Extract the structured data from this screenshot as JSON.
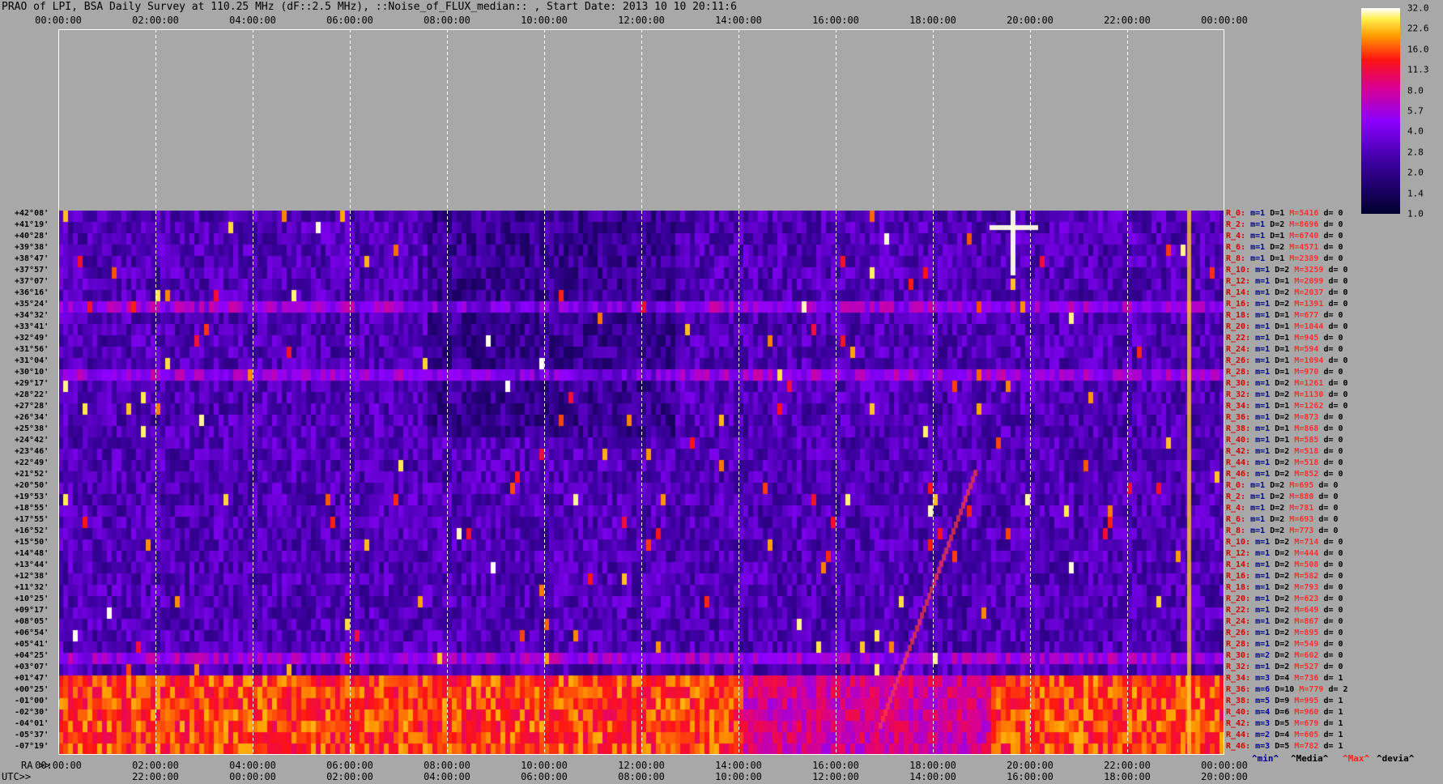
{
  "title": "PRAO of LPI, BSA Daily Survey at 110.25 MHz (dF::2.5 MHz), ::Noise_of_FLUX_median:: , Start Date: 2013 10 10 20:11:6",
  "colors": {
    "background": "#a8a8a8",
    "grid": "#ffffff",
    "low": "#000040",
    "mid": "#8800ff",
    "high": "#ffffff"
  },
  "top_axis_ticks": [
    "00:00:00",
    "02:00:00",
    "04:00:00",
    "06:00:00",
    "08:00:00",
    "10:00:00",
    "12:00:00",
    "14:00:00",
    "16:00:00",
    "18:00:00",
    "20:00:00",
    "22:00:00",
    "00:00:00"
  ],
  "bottom_axis": {
    "ra_label": "RA >>",
    "utc_label": "UTC>>",
    "ra_ticks": [
      "00:00:00",
      "02:00:00",
      "04:00:00",
      "06:00:00",
      "08:00:00",
      "10:00:00",
      "12:00:00",
      "14:00:00",
      "16:00:00",
      "18:00:00",
      "20:00:00",
      "22:00:00",
      "00:00:00"
    ],
    "utc_ticks": [
      "22:00:00",
      "00:00:00",
      "02:00:00",
      "04:00:00",
      "06:00:00",
      "08:00:00",
      "10:00:00",
      "12:00:00",
      "14:00:00",
      "16:00:00",
      "18:00:00",
      "20:00:00"
    ]
  },
  "footer_labels": {
    "min": "^min^",
    "median": "^Media^",
    "max": "^Max^",
    "devia": "^devia^"
  },
  "colorbar_ticks": [
    "32.0",
    "22.6",
    "16.0",
    "11.3",
    "8.0",
    "5.7",
    "4.0",
    "2.8",
    "2.0",
    "1.4",
    "1.0"
  ],
  "chart_data": {
    "type": "heatmap",
    "title": "PRAO of LPI, BSA Daily Survey at 110.25 MHz (dF::2.5 MHz), ::Noise_of_FLUX_median:: , Start Date: 2013 10 10 20:11:6",
    "x_axis": "RA / UTC hours",
    "scale": [
      1.0,
      32.0
    ],
    "declinations": [
      "+42°08'",
      "+41°19'",
      "+40°28'",
      "+39°38'",
      "+38°47'",
      "+37°57'",
      "+37°07'",
      "+36°16'",
      "+35°24'",
      "+34°32'",
      "+33°41'",
      "+32°49'",
      "+31°56'",
      "+31°04'",
      "+30°10'",
      "+29°17'",
      "+28°22'",
      "+27°28'",
      "+26°34'",
      "+25°38'",
      "+24°42'",
      "+23°46'",
      "+22°49'",
      "+21°52'",
      "+20°50'",
      "+19°53'",
      "+18°55'",
      "+17°55'",
      "+16°52'",
      "+15°50'",
      "+14°48'",
      "+13°44'",
      "+12°38'",
      "+11°32'",
      "+10°25'",
      "+09°17'",
      "+08°05'",
      "+06°54'",
      "+05°41'",
      "+04°25'",
      "+03°07'",
      "+01°47'",
      "+00°25'",
      "-01°00'",
      "-02°30'",
      "-04°01'",
      "-05°37'",
      "-07°19'"
    ],
    "row_stats": [
      {
        "r": "R_0:",
        "m": "m=1",
        "D": "D=1",
        "M": "M=5416",
        "d": "d= 0"
      },
      {
        "r": "R_2:",
        "m": "m=1",
        "D": "D=2",
        "M": "M=8696",
        "d": "d= 0"
      },
      {
        "r": "R_4:",
        "m": "m=1",
        "D": "D=1",
        "M": "M=6740",
        "d": "d= 0"
      },
      {
        "r": "R_6:",
        "m": "m=1",
        "D": "D=2",
        "M": "M=4571",
        "d": "d= 0"
      },
      {
        "r": "R_8:",
        "m": "m=1",
        "D": "D=1",
        "M": "M=2389",
        "d": "d= 0"
      },
      {
        "r": "R_10:",
        "m": "m=1",
        "D": "D=2",
        "M": "M=3259",
        "d": "d= 0"
      },
      {
        "r": "R_12:",
        "m": "m=1",
        "D": "D=1",
        "M": "M=2099",
        "d": "d= 0"
      },
      {
        "r": "R_14:",
        "m": "m=1",
        "D": "D=2",
        "M": "M=2037",
        "d": "d= 0"
      },
      {
        "r": "R_16:",
        "m": "m=1",
        "D": "D=2",
        "M": "M=1391",
        "d": "d= 0"
      },
      {
        "r": "R_18:",
        "m": "m=1",
        "D": "D=1",
        "M": "M=677",
        "d": "d= 0"
      },
      {
        "r": "R_20:",
        "m": "m=1",
        "D": "D=1",
        "M": "M=1044",
        "d": "d= 0"
      },
      {
        "r": "R_22:",
        "m": "m=1",
        "D": "D=1",
        "M": "M=945",
        "d": "d= 0"
      },
      {
        "r": "R_24:",
        "m": "m=1",
        "D": "D=1",
        "M": "M=594",
        "d": "d= 0"
      },
      {
        "r": "R_26:",
        "m": "m=1",
        "D": "D=1",
        "M": "M=1094",
        "d": "d= 0"
      },
      {
        "r": "R_28:",
        "m": "m=1",
        "D": "D=1",
        "M": "M=970",
        "d": "d= 0"
      },
      {
        "r": "R_30:",
        "m": "m=1",
        "D": "D=2",
        "M": "M=1261",
        "d": "d= 0"
      },
      {
        "r": "R_32:",
        "m": "m=1",
        "D": "D=2",
        "M": "M=1130",
        "d": "d= 0"
      },
      {
        "r": "R_34:",
        "m": "m=1",
        "D": "D=1",
        "M": "M=1262",
        "d": "d= 0"
      },
      {
        "r": "R_36:",
        "m": "m=1",
        "D": "D=2",
        "M": "M=873",
        "d": "d= 0"
      },
      {
        "r": "R_38:",
        "m": "m=1",
        "D": "D=1",
        "M": "M=868",
        "d": "d= 0"
      },
      {
        "r": "R_40:",
        "m": "m=1",
        "D": "D=1",
        "M": "M=585",
        "d": "d= 0"
      },
      {
        "r": "R_42:",
        "m": "m=1",
        "D": "D=2",
        "M": "M=518",
        "d": "d= 0"
      },
      {
        "r": "R_44:",
        "m": "m=1",
        "D": "D=2",
        "M": "M=518",
        "d": "d= 0"
      },
      {
        "r": "R_46:",
        "m": "m=1",
        "D": "D=2",
        "M": "M=852",
        "d": "d= 0"
      },
      {
        "r": "R_0:",
        "m": "m=1",
        "D": "D=2",
        "M": "M=695",
        "d": "d= 0"
      },
      {
        "r": "R_2:",
        "m": "m=1",
        "D": "D=2",
        "M": "M=880",
        "d": "d= 0"
      },
      {
        "r": "R_4:",
        "m": "m=1",
        "D": "D=2",
        "M": "M=781",
        "d": "d= 0"
      },
      {
        "r": "R_6:",
        "m": "m=1",
        "D": "D=2",
        "M": "M=693",
        "d": "d= 0"
      },
      {
        "r": "R_8:",
        "m": "m=1",
        "D": "D=2",
        "M": "M=773",
        "d": "d= 0"
      },
      {
        "r": "R_10:",
        "m": "m=1",
        "D": "D=2",
        "M": "M=714",
        "d": "d= 0"
      },
      {
        "r": "R_12:",
        "m": "m=1",
        "D": "D=2",
        "M": "M=444",
        "d": "d= 0"
      },
      {
        "r": "R_14:",
        "m": "m=1",
        "D": "D=2",
        "M": "M=508",
        "d": "d= 0"
      },
      {
        "r": "R_16:",
        "m": "m=1",
        "D": "D=2",
        "M": "M=582",
        "d": "d= 0"
      },
      {
        "r": "R_18:",
        "m": "m=1",
        "D": "D=2",
        "M": "M=793",
        "d": "d= 0"
      },
      {
        "r": "R_20:",
        "m": "m=1",
        "D": "D=2",
        "M": "M=623",
        "d": "d= 0"
      },
      {
        "r": "R_22:",
        "m": "m=1",
        "D": "D=2",
        "M": "M=649",
        "d": "d= 0"
      },
      {
        "r": "R_24:",
        "m": "m=1",
        "D": "D=2",
        "M": "M=867",
        "d": "d= 0"
      },
      {
        "r": "R_26:",
        "m": "m=1",
        "D": "D=2",
        "M": "M=895",
        "d": "d= 0"
      },
      {
        "r": "R_28:",
        "m": "m=1",
        "D": "D=2",
        "M": "M=549",
        "d": "d= 0"
      },
      {
        "r": "R_30:",
        "m": "m=2",
        "D": "D=2",
        "M": "M=602",
        "d": "d= 0"
      },
      {
        "r": "R_32:",
        "m": "m=1",
        "D": "D=2",
        "M": "M=527",
        "d": "d= 0"
      },
      {
        "r": "R_34:",
        "m": "m=3",
        "D": "D=4",
        "M": "M=736",
        "d": "d= 1"
      },
      {
        "r": "R_36:",
        "m": "m=6",
        "D": "D=10",
        "M": "M=779",
        "d": "d= 2"
      },
      {
        "r": "R_38:",
        "m": "m=5",
        "D": "D=9",
        "M": "M=995",
        "d": "d= 1"
      },
      {
        "r": "R_40:",
        "m": "m=4",
        "D": "D=6",
        "M": "M=960",
        "d": "d= 1"
      },
      {
        "r": "R_42:",
        "m": "m=3",
        "D": "D=5",
        "M": "M=679",
        "d": "d= 1"
      },
      {
        "r": "R_44:",
        "m": "m=2",
        "D": "D=4",
        "M": "M=605",
        "d": "d= 1"
      },
      {
        "r": "R_46:",
        "m": "m=3",
        "D": "D=5",
        "M": "M=782",
        "d": "d= 1"
      }
    ]
  }
}
